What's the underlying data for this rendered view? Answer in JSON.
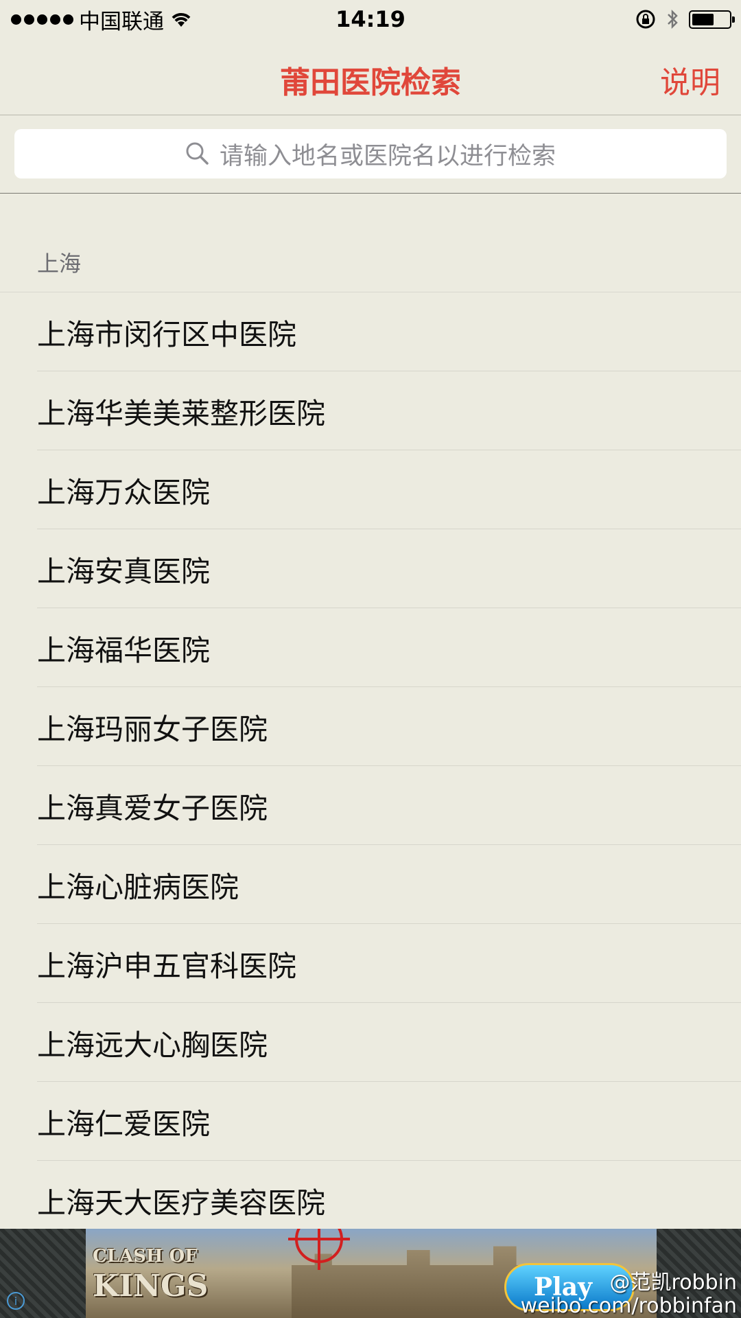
{
  "status_bar": {
    "carrier": "中国联通",
    "time": "14:19",
    "battery_level": 0.6
  },
  "nav": {
    "title": "莆田医院检索",
    "right_button": "说明"
  },
  "search": {
    "placeholder": "请输入地名或医院名以进行检索"
  },
  "section": {
    "header": "上海",
    "items": [
      "上海市闵行区中医院",
      "上海华美美莱整形医院",
      "上海万众医院",
      "上海安真医院",
      "上海福华医院",
      "上海玛丽女子医院",
      "上海真爱女子医院",
      "上海心脏病医院",
      "上海沪申五官科医院",
      "上海远大心胸医院",
      "上海仁爱医院",
      "上海天大医疗美容医院"
    ]
  },
  "ad": {
    "logo_line1": "CLASH OF",
    "logo_line2": "KINGS",
    "play_label": "Play"
  },
  "watermark": {
    "line1": "@范凯robbin",
    "line2": "weibo.com/robbinfan"
  },
  "colors": {
    "accent": "#e0473a",
    "background": "#ecebe0"
  }
}
